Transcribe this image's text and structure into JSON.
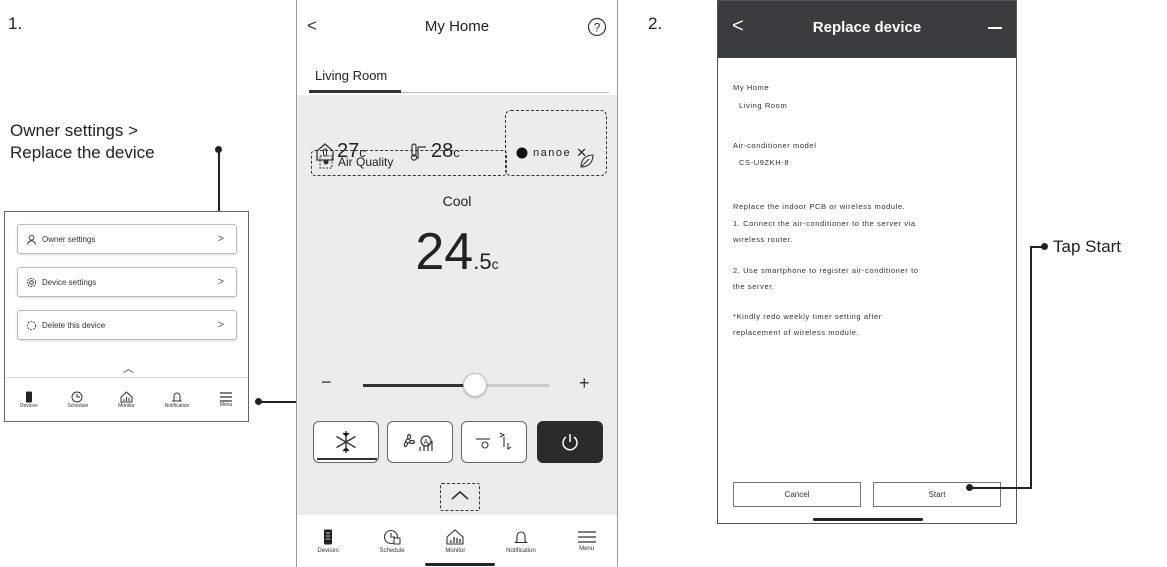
{
  "steps": {
    "one": "1.",
    "two": "2."
  },
  "callouts": {
    "owner_settings_line1": "Owner settings >",
    "owner_settings_line2": "Replace the device",
    "tap_start": "Tap Start"
  },
  "menu_panel": {
    "items": [
      {
        "label": "Owner settings",
        "icon": "person-icon"
      },
      {
        "label": "Device settings",
        "icon": "gear-icon"
      },
      {
        "label": "Delete this device",
        "icon": "dashed-circle-icon"
      }
    ],
    "nav": [
      "Devices",
      "Schedule",
      "Monitor",
      "Notification",
      "Menu"
    ]
  },
  "home_screen": {
    "title": "My Home",
    "tab": "Living Room",
    "indoor_temp": "27",
    "outdoor_temp": "28",
    "temp_unit": "c",
    "brand": "nanoe",
    "air_quality": "Air Quality",
    "mode": "Cool",
    "set_temp_int": "24",
    "set_temp_dec": ".5",
    "set_temp_unit": "c",
    "slider_level": 0.6,
    "minus": "−",
    "plus": "+",
    "nav": [
      "Devices",
      "Schedule",
      "Monitor",
      "Notification",
      "Menu"
    ]
  },
  "replace_screen": {
    "title": "Replace device",
    "home_label": "My Home",
    "room": "Living Room",
    "model_label": "Air-conditioner model",
    "model": "CS-U9ZKH-8",
    "intro": "Replace the indoor PCB or wireless module.",
    "step1_a": "1. Connect the air-conditioner to the server via",
    "step1_b": "wireless router.",
    "step2_a": "2. Use smartphone to register air-conditioner to",
    "step2_b": "the server.",
    "note_a": "*Kindly redo weekly timer setting after",
    "note_b": "replacement of wireless module.",
    "cancel": "Cancel",
    "start": "Start"
  },
  "colors": {
    "header_dark": "#3a3d3f",
    "gray_panel": "#ececec",
    "off_button": "#2b2b2b"
  }
}
